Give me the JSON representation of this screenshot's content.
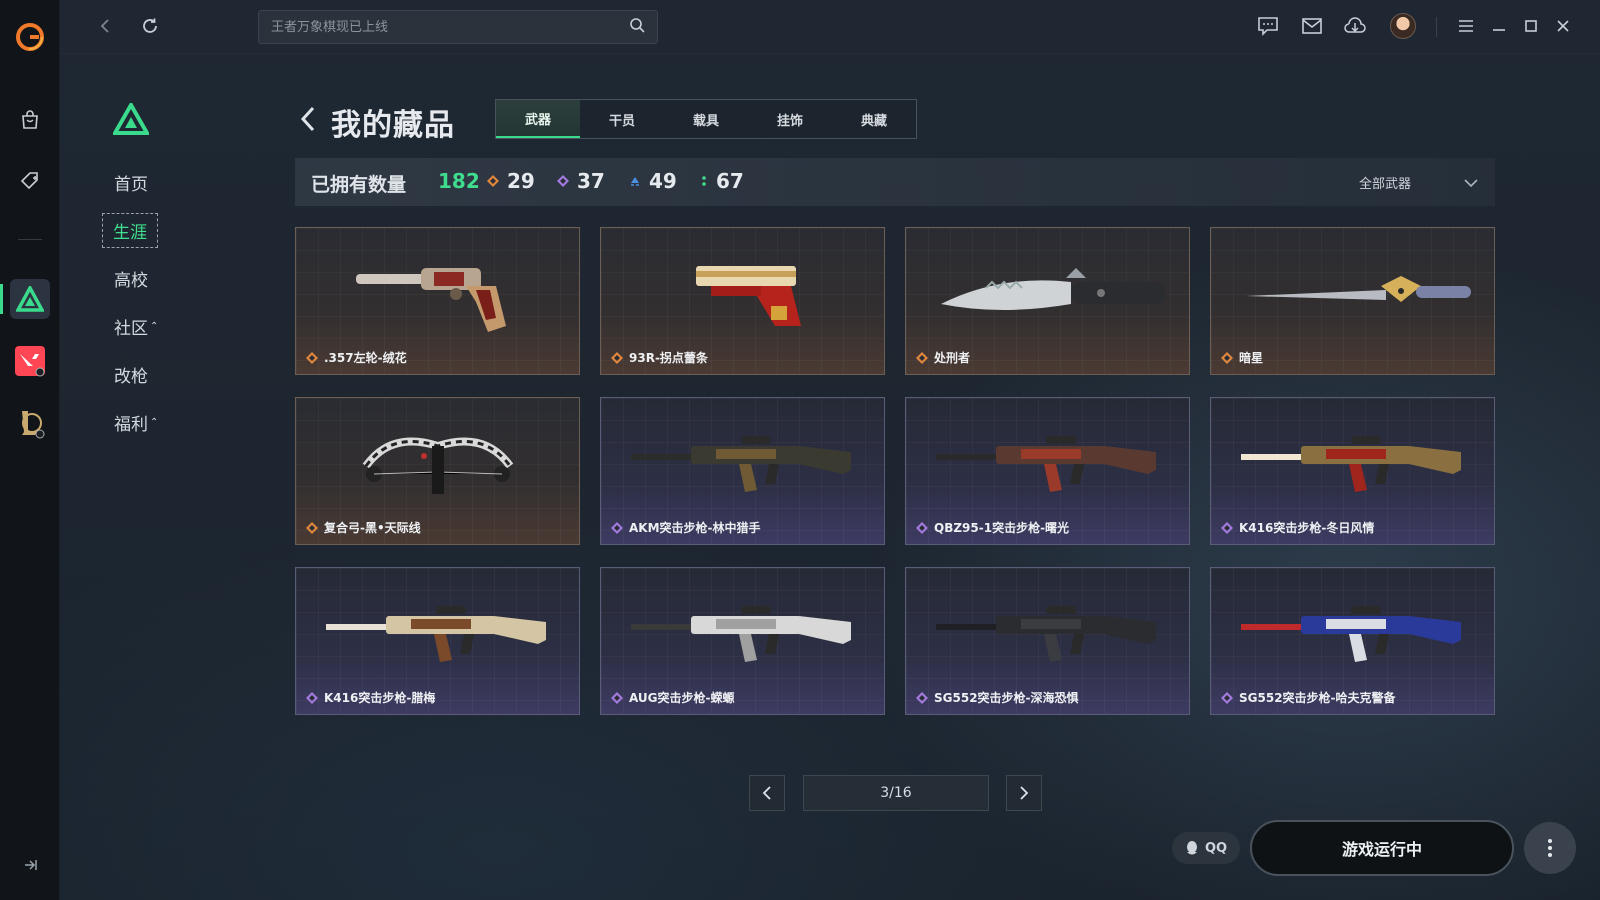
{
  "app": {
    "search_placeholder": "王者万象棋现已上线"
  },
  "colors": {
    "accent_green": "#3adb8c",
    "rarity_orange": "#e0873d",
    "rarity_purple": "#a27ae0",
    "rarity_blue": "#4b8fe0",
    "rarity_green": "#3fdc8d"
  },
  "nav": {
    "items": [
      {
        "label": "首页",
        "caret": ""
      },
      {
        "label": "生涯",
        "caret": "",
        "active": true
      },
      {
        "label": "高校",
        "caret": ""
      },
      {
        "label": "社区",
        "caret": "⌃"
      },
      {
        "label": "改枪",
        "caret": ""
      },
      {
        "label": "福利",
        "caret": "⌃"
      }
    ]
  },
  "header": {
    "title": "我的藏品",
    "tabs": [
      {
        "label": "武器",
        "active": true
      },
      {
        "label": "干员"
      },
      {
        "label": "载具"
      },
      {
        "label": "挂饰"
      },
      {
        "label": "典藏"
      }
    ]
  },
  "stats": {
    "owned_label": "已拥有数量",
    "owned_total": "182",
    "rarity_counts": [
      {
        "icon": "orange-diamond-icon",
        "value": "29"
      },
      {
        "icon": "purple-diamond-icon",
        "value": "37"
      },
      {
        "icon": "blue-diamond-icon",
        "value": "49"
      },
      {
        "icon": "green-dots-icon",
        "value": "67"
      }
    ],
    "filter_label": "全部武器"
  },
  "items": [
    {
      "name": ".357左轮-绒花",
      "rarity": "orange",
      "icon": "revolver-icon"
    },
    {
      "name": "93R-拐点蕾条",
      "rarity": "orange",
      "icon": "pistol-icon"
    },
    {
      "name": "处刑者",
      "rarity": "orange",
      "icon": "knife-icon"
    },
    {
      "name": "暗星",
      "rarity": "orange",
      "icon": "blade-icon"
    },
    {
      "name": "复合弓-黑•天际线",
      "rarity": "orange",
      "icon": "compound-bow-icon"
    },
    {
      "name": "AKM突击步枪-林中猎手",
      "rarity": "purple",
      "icon": "rifle-icon"
    },
    {
      "name": "QBZ95-1突击步枪-曙光",
      "rarity": "purple",
      "icon": "rifle-icon"
    },
    {
      "name": "K416突击步枪-冬日风情",
      "rarity": "purple",
      "icon": "rifle-icon"
    },
    {
      "name": "K416突击步枪-腊梅",
      "rarity": "purple",
      "icon": "rifle-icon"
    },
    {
      "name": "AUG突击步枪-蝾螈",
      "rarity": "purple",
      "icon": "rifle-icon"
    },
    {
      "name": "SG552突击步枪-深海恐惧",
      "rarity": "purple",
      "icon": "rifle-icon"
    },
    {
      "name": "SG552突击步枪-哈夫克警备",
      "rarity": "purple",
      "icon": "rifle-icon"
    }
  ],
  "pager": {
    "label": "3/16"
  },
  "footer": {
    "qq_label": "QQ",
    "launch_label": "游戏运行中"
  }
}
